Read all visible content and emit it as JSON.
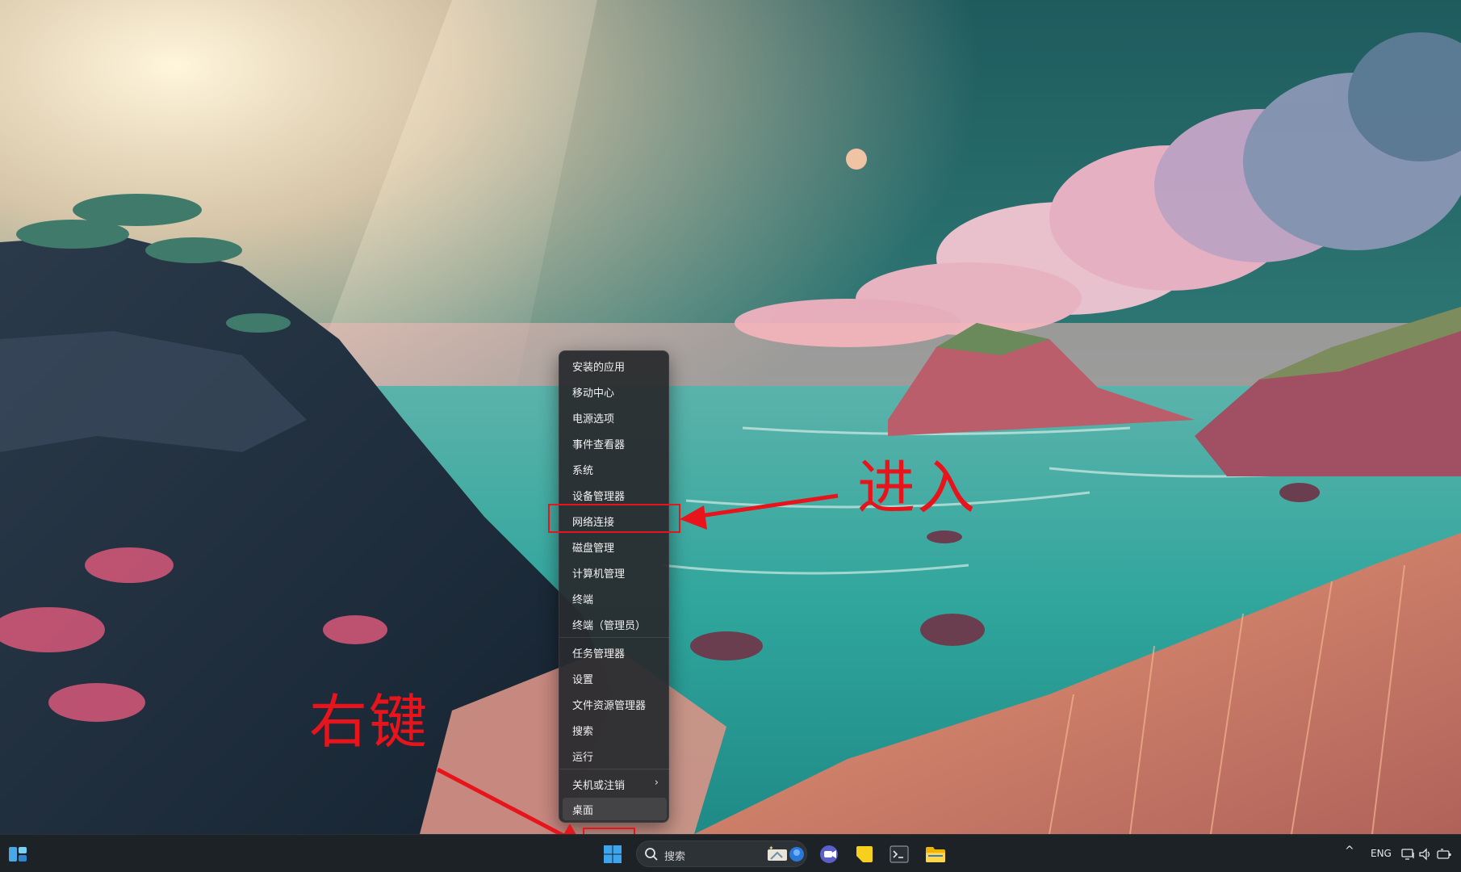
{
  "context_menu": {
    "items": [
      {
        "label": "安装的应用"
      },
      {
        "label": "移动中心"
      },
      {
        "label": "电源选项"
      },
      {
        "label": "事件查看器"
      },
      {
        "label": "系统"
      },
      {
        "label": "设备管理器"
      },
      {
        "label": "网络连接",
        "highlighted": true
      },
      {
        "label": "磁盘管理"
      },
      {
        "label": "计算机管理"
      },
      {
        "label": "终端"
      },
      {
        "label": "终端（管理员）"
      },
      {
        "label": "任务管理器"
      },
      {
        "label": "设置"
      },
      {
        "label": "文件资源管理器"
      },
      {
        "label": "搜索"
      },
      {
        "label": "运行"
      },
      {
        "label": "关机或注销",
        "submenu_icon": "chevron-right-icon",
        "submenu_glyph": "›"
      },
      {
        "label": "桌面",
        "hovered": true
      }
    ]
  },
  "annotations": {
    "enter_label": "进入",
    "right_click_label": "右键",
    "color": "#e8141b"
  },
  "taskbar": {
    "widgets_icon": "widgets-icon",
    "start_icon": "windows-start-icon",
    "search_placeholder": "搜索",
    "pinned_apps": [
      "teams-chat-icon",
      "sticky-notes-icon",
      "terminal-icon",
      "file-explorer-icon"
    ],
    "tray": {
      "chevron_glyph": "^",
      "language": "ENG",
      "icons": [
        "network-icon",
        "volume-icon",
        "battery-icon"
      ]
    }
  }
}
